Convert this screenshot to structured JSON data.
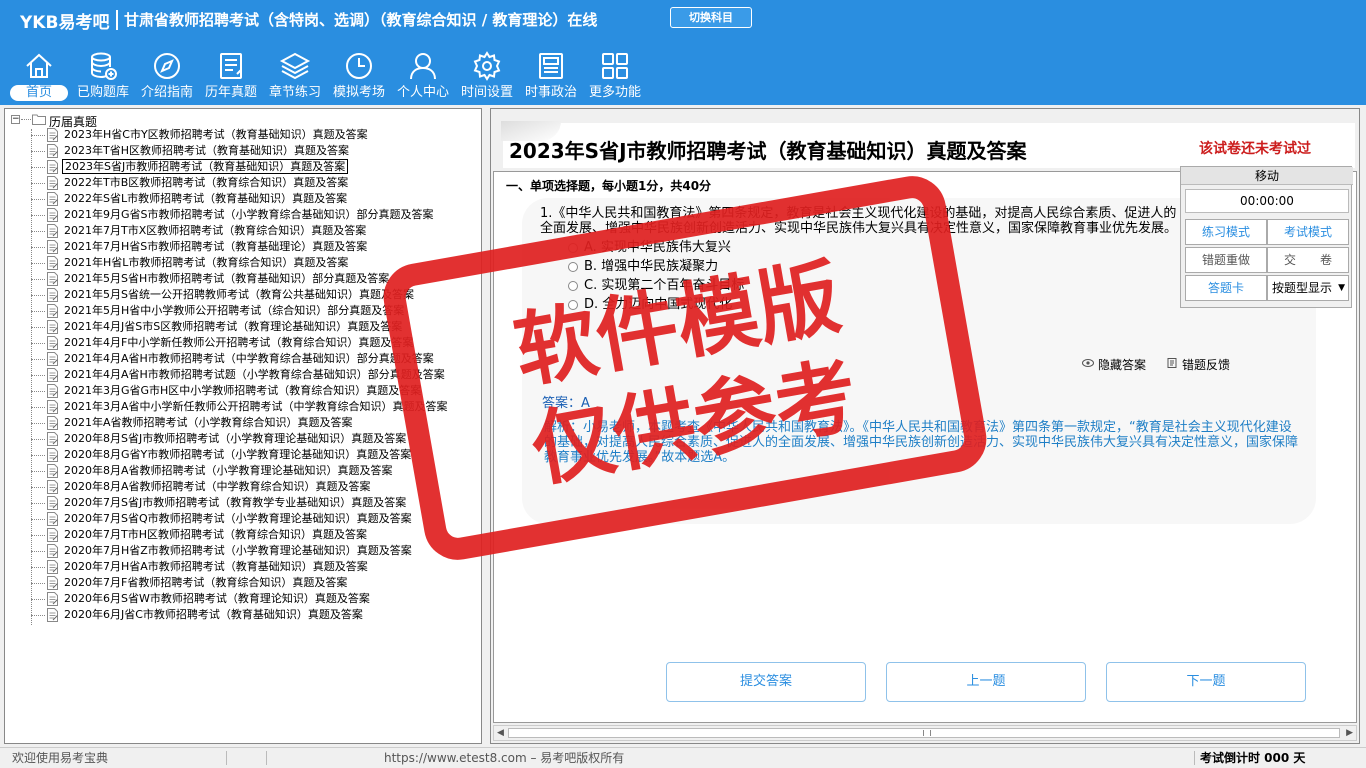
{
  "header": {
    "logo": "YKB易考吧",
    "title": "甘肃省教师招聘考试（含特岗、选调）（教育综合知识 / 教育理论）在线",
    "switch_label": "切换科目"
  },
  "nav": [
    {
      "label": "首页",
      "icon": "home-icon",
      "active": true
    },
    {
      "label": "已购题库",
      "icon": "database-icon"
    },
    {
      "label": "介绍指南",
      "icon": "compass-icon"
    },
    {
      "label": "历年真题",
      "icon": "document-list-icon"
    },
    {
      "label": "章节练习",
      "icon": "layers-icon"
    },
    {
      "label": "模拟考场",
      "icon": "clock-icon"
    },
    {
      "label": "个人中心",
      "icon": "user-icon"
    },
    {
      "label": "时间设置",
      "icon": "gear-icon"
    },
    {
      "label": "时事政治",
      "icon": "newspaper-icon"
    },
    {
      "label": "更多功能",
      "icon": "grid-icon"
    }
  ],
  "tree": {
    "root": "历届真题",
    "items": [
      "2023年H省C市Y区教师招聘考试（教育基础知识）真题及答案",
      "2023年T省H区教师招聘考试（教育基础知识）真题及答案",
      "2023年S省J市教师招聘考试（教育基础知识）真题及答案",
      "2022年T市B区教师招聘考试（教育综合知识）真题及答案",
      "2022年S省L市教师招聘考试（教育基础知识）真题及答案",
      "2021年9月G省S市教师招聘考试（小学教育综合基础知识）部分真题及答案",
      "2021年7月T市X区教师招聘考试（教育综合知识）真题及答案",
      "2021年7月H省S市教师招聘考试（教育基础理论）真题及答案",
      "2021年H省L市教师招聘考试（教育综合知识）真题及答案",
      "2021年5月S省H市教师招聘考试（教育基础知识）部分真题及答案",
      "2021年5月S省统一公开招聘教师考试（教育公共基础知识）真题及答案",
      "2021年5月H省中小学教师公开招聘考试（综合知识）部分真题及答案",
      "2021年4月J省S市S区教师招聘考试（教育理论基础知识）真题及答案",
      "2021年4月F中小学新任教师公开招聘考试（教育综合知识）真题及答案",
      "2021年4月A省H市教师招聘考试（中学教育综合基础知识）部分真题及答案",
      "2021年4月A省H市教师招聘考试题（小学教育综合基础知识）部分真题及答案",
      "2021年3月G省G市H区中小学教师招聘考试（教育综合知识）真题及答案",
      "2021年3月A省中小学新任教师公开招聘考试（中学教育综合知识）真题及答案",
      "2021年A省教师招聘考试（小学教育综合知识）真题及答案",
      "2020年8月S省J市教师招聘考试（小学教育理论基础知识）真题及答案",
      "2020年8月G省Y市教师招聘考试（小学教育理论基础知识）真题及答案",
      "2020年8月A省教师招聘考试（小学教育理论基础知识）真题及答案",
      "2020年8月A省教师招聘考试（中学教育综合知识）真题及答案",
      "2020年7月S省J市教师招聘考试（教育教学专业基础知识）真题及答案",
      "2020年7月S省Q市教师招聘考试（小学教育理论基础知识）真题及答案",
      "2020年7月T市H区教师招聘考试（教育综合知识）真题及答案",
      "2020年7月H省Z市教师招聘考试（小学教育理论基础知识）真题及答案",
      "2020年7月H省A市教师招聘考试（教育基础知识）真题及答案",
      "2020年7月F省教师招聘考试（教育综合知识）真题及答案",
      "2020年6月S省W市教师招聘考试（教育理论知识）真题及答案",
      "2020年6月J省C市教师招聘考试（教育基础知识）真题及答案"
    ],
    "selected_index": 2
  },
  "paper": {
    "title": "2023年S省J市教师招聘考试（教育基础知识）真题及答案",
    "status": "该试卷还未考试过",
    "section": "一、单项选择题，每小题1分，共40分"
  },
  "question": {
    "text": "1.《中华人民共和国教育法》第四条规定，教育是社会主义现代化建设的基础，对提高人民综合素质、促进人的全面发展、增强中华民族创新创造活力、实现中华民族伟大复兴具有决定性意义，国家保障教育事业优先发展。",
    "options": [
      "A. 实现中华民族伟大复兴",
      "B. 增强中华民族凝聚力",
      "C. 实现第二个百年奋斗目标",
      "D. 全力迈向中国式现代化"
    ],
    "hide_answer_label": "隐藏答案",
    "report_error_label": "错题反馈",
    "answer_label": "答案：A",
    "analysis": "解析：小易老师，本题考查《中华人民共和国教育法》。《中华人民共和国教育法》第四条第一款规定，“教育是社会主义现代化建设的基础，对提高人民综合素质、促进人的全面发展、增强中华民族创新创造活力、实现中华民族伟大复兴具有决定性意义，国家保障教育事业优先发展。”故本题选A。"
  },
  "buttons": {
    "submit": "提交答案",
    "prev": "上一题",
    "next": "下一题"
  },
  "float_panel": {
    "title": "移动",
    "timer": "00:00:00",
    "practice_mode": "练习模式",
    "exam_mode": "考试模式",
    "redo_wrong": "错题重做",
    "submit_paper": "交　　卷",
    "left_btn": "答题卡",
    "mode_select": "按题型显示"
  },
  "watermark": {
    "line1": "软件模版",
    "line2": "仅供参考"
  },
  "statusbar": {
    "welcome": "欢迎使用易考宝典",
    "copyright": "https://www.etest8.com – 易考吧版权所有",
    "countdown": "考试倒计时 000 天"
  }
}
